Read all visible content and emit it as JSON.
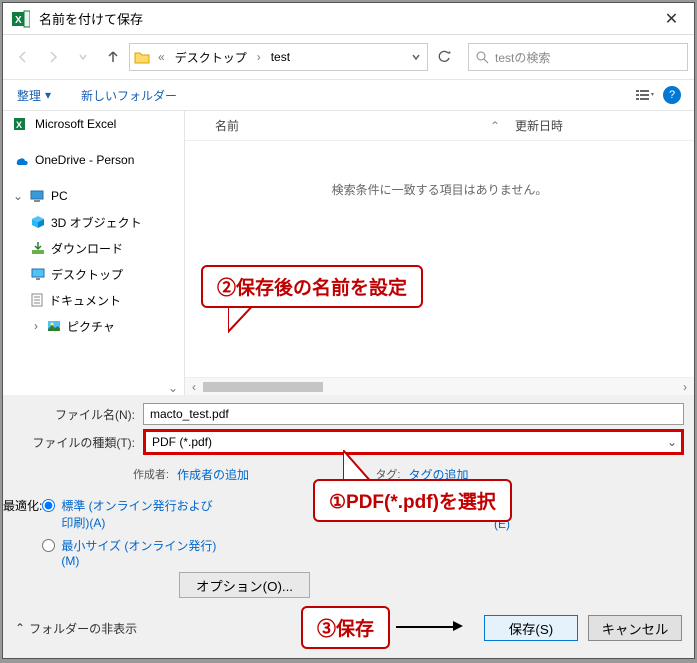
{
  "titlebar": {
    "title": "名前を付けて保存"
  },
  "nav": {
    "breadcrumb": [
      "デスクトップ",
      "test"
    ],
    "search_placeholder": "testの検索"
  },
  "toolbar": {
    "organize": "整理",
    "newfolder": "新しいフォルダー"
  },
  "tree": {
    "items": [
      {
        "label": "Microsoft Excel",
        "icon": "excel"
      },
      {
        "label": "OneDrive - Person",
        "icon": "onedrive"
      },
      {
        "label": "PC",
        "icon": "pc",
        "expandable": true
      },
      {
        "label": "3D オブジェクト",
        "icon": "3d",
        "indent": 1
      },
      {
        "label": "ダウンロード",
        "icon": "download",
        "indent": 1
      },
      {
        "label": "デスクトップ",
        "icon": "desktop",
        "indent": 1
      },
      {
        "label": "ドキュメント",
        "icon": "doc",
        "indent": 1
      },
      {
        "label": "ピクチャ",
        "icon": "picture",
        "indent": 1,
        "expandable": true
      }
    ]
  },
  "filepane": {
    "col_name": "名前",
    "col_date": "更新日時",
    "empty": "検索条件に一致する項目はありません。"
  },
  "form": {
    "filename_label": "ファイル名(N):",
    "filename_value": "macto_test.pdf",
    "filetype_label": "ファイルの種類(T):",
    "filetype_value": "PDF (*.pdf)",
    "author_label": "作成者:",
    "author_value": "作成者の追加",
    "tag_label": "タグ:",
    "tag_value": "タグの追加",
    "optimize_label": "最適化:",
    "opt_standard": "標準 (オンライン発行および印刷)(A)",
    "opt_min": "最小サイズ (オンライン発行)(M)",
    "openafter": "(E)",
    "options_btn": "オプション(O)..."
  },
  "footer": {
    "hide": "フォルダーの非表示",
    "save": "保存(S)",
    "cancel": "キャンセル"
  },
  "callouts": {
    "c1": "①PDF(*.pdf)を選択",
    "c2": "②保存後の名前を設定",
    "c3": "③保存"
  }
}
